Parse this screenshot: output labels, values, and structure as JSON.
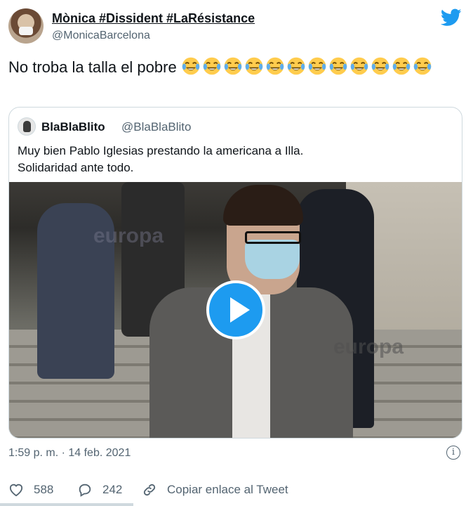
{
  "tweet": {
    "author_name": "Mònica #Dissident #LaRésistance",
    "author_handle": "@MonicaBarcelona",
    "text": "No troba la talla el pobre",
    "emoji_count": 12,
    "emoji_icon": "face-with-tears-of-joy-icon"
  },
  "quoted_tweet": {
    "author_name": "BlaBlaBlito",
    "author_handle": "@BlaBlaBlito",
    "text": "Muy bien Pablo Iglesias prestando la americana a Illa.\nSolidaridad ante todo.",
    "video_watermark": "europa"
  },
  "meta": {
    "timestamp": "1:59 p. m. · 14 feb. 2021"
  },
  "actions": {
    "likes": "588",
    "replies": "242",
    "copy_link_label": "Copiar enlace al Tweet"
  },
  "colors": {
    "brand": "#1d9bf0",
    "text": "#0f1419",
    "secondary": "#536471",
    "border": "#cfd9de"
  }
}
